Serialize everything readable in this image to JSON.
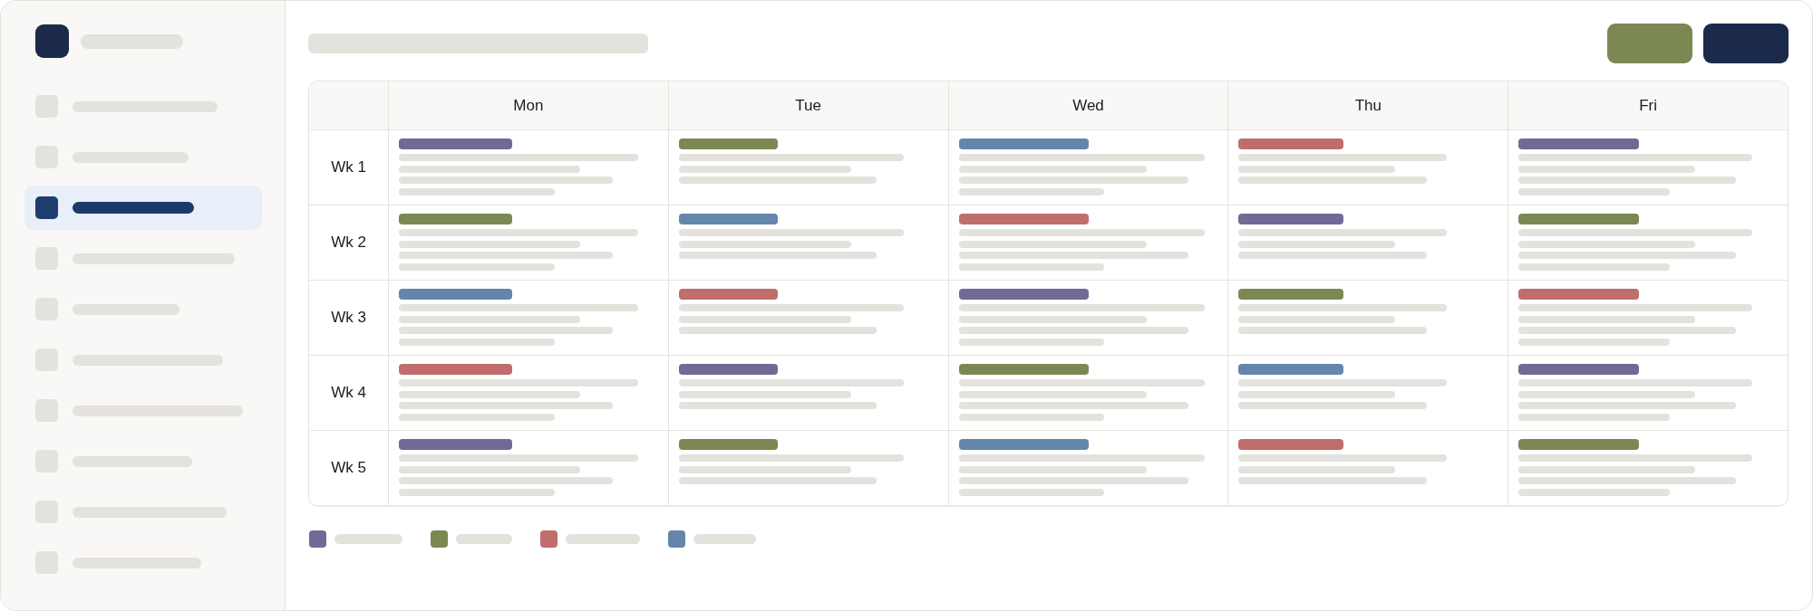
{
  "sidebar": {
    "items": [
      {
        "selected": false
      },
      {
        "selected": false
      },
      {
        "selected": true
      },
      {
        "selected": false
      },
      {
        "selected": false
      },
      {
        "selected": false
      },
      {
        "selected": false
      },
      {
        "selected": false
      },
      {
        "selected": false
      },
      {
        "selected": false
      }
    ]
  },
  "header": {
    "actions": [
      {
        "kind": "secondary"
      },
      {
        "kind": "primary"
      }
    ]
  },
  "table": {
    "columns": [
      "Mon",
      "Tue",
      "Wed",
      "Thu",
      "Fri"
    ],
    "rows": [
      {
        "label": "Wk 1",
        "cells": [
          {
            "color": "#6f6a96",
            "kind": "long"
          },
          {
            "color": "#7c8853",
            "kind": "short"
          },
          {
            "color": "#6486aa",
            "kind": "long"
          },
          {
            "color": "#bf6e6c",
            "kind": "short"
          },
          {
            "color": "#6f6a96",
            "kind": "long"
          }
        ]
      },
      {
        "label": "Wk 2",
        "cells": [
          {
            "color": "#7c8853",
            "kind": "long"
          },
          {
            "color": "#6486aa",
            "kind": "short"
          },
          {
            "color": "#bf6e6c",
            "kind": "long"
          },
          {
            "color": "#6f6a96",
            "kind": "short"
          },
          {
            "color": "#7c8853",
            "kind": "long"
          }
        ]
      },
      {
        "label": "Wk 3",
        "cells": [
          {
            "color": "#6486aa",
            "kind": "long"
          },
          {
            "color": "#bf6e6c",
            "kind": "short"
          },
          {
            "color": "#6f6a96",
            "kind": "long"
          },
          {
            "color": "#7c8853",
            "kind": "short"
          },
          {
            "color": "#bf6e6c",
            "kind": "long"
          }
        ]
      },
      {
        "label": "Wk 4",
        "cells": [
          {
            "color": "#bf6e6c",
            "kind": "long"
          },
          {
            "color": "#6f6a96",
            "kind": "short"
          },
          {
            "color": "#7c8853",
            "kind": "long"
          },
          {
            "color": "#6486aa",
            "kind": "short"
          },
          {
            "color": "#6f6a96",
            "kind": "long"
          }
        ]
      },
      {
        "label": "Wk 5",
        "cells": [
          {
            "color": "#6f6a96",
            "kind": "long"
          },
          {
            "color": "#7c8853",
            "kind": "short"
          },
          {
            "color": "#6486aa",
            "kind": "long"
          },
          {
            "color": "#bf6e6c",
            "kind": "short"
          },
          {
            "color": "#7c8853",
            "kind": "long"
          }
        ]
      }
    ]
  },
  "legend": [
    {
      "color": "#6f6a96"
    },
    {
      "color": "#7c8853"
    },
    {
      "color": "#bf6e6c"
    },
    {
      "color": "#6486aa"
    }
  ]
}
